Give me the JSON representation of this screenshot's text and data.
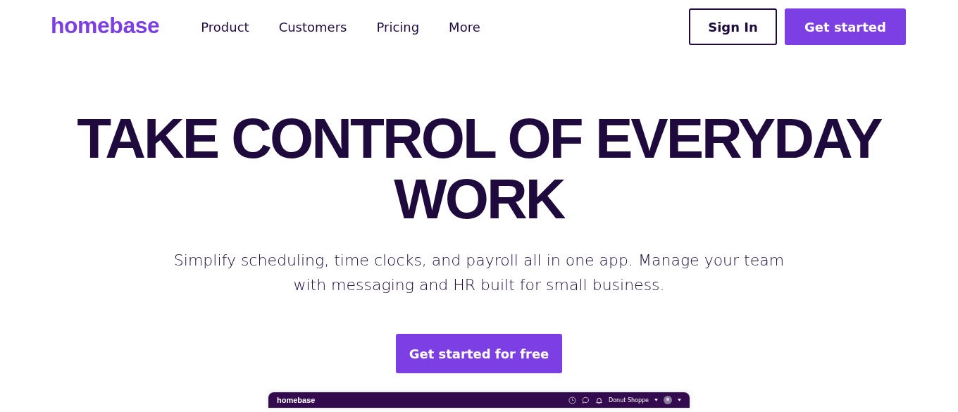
{
  "header": {
    "logo": "homebase",
    "nav": [
      "Product",
      "Customers",
      "Pricing",
      "More"
    ],
    "sign_in": "Sign In",
    "get_started": "Get started"
  },
  "hero": {
    "title_lines": [
      "TAKE CONTROL OF EVERYDAY",
      "WORK"
    ],
    "subtitle_lines": [
      "Simplify scheduling, time clocks, and payroll all in one app. Manage your team",
      "with messaging and HR built for small business."
    ],
    "cta": "Get started for free"
  },
  "app_preview": {
    "logo": "homebase",
    "location": "Donut Shoppe"
  }
}
